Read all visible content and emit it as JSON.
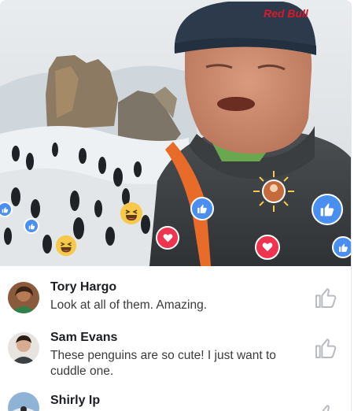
{
  "video": {
    "hat_text": "Red Bull",
    "reactions": [
      {
        "type": "like",
        "icon": "thumbs-up-icon"
      },
      {
        "type": "love",
        "icon": "heart-icon"
      },
      {
        "type": "haha",
        "icon": "laughing-face-icon"
      }
    ],
    "colors": {
      "like": "#4a8ff0",
      "love": "#f0334f",
      "haha": "#f7c84a"
    }
  },
  "comments": [
    {
      "name": "Tory Hargo",
      "text": "Look at all of them. Amazing."
    },
    {
      "name": "Sam Evans",
      "text": "These penguins are so cute! I just want to cuddle one."
    },
    {
      "name": "Shirly Ip",
      "text": ""
    }
  ]
}
